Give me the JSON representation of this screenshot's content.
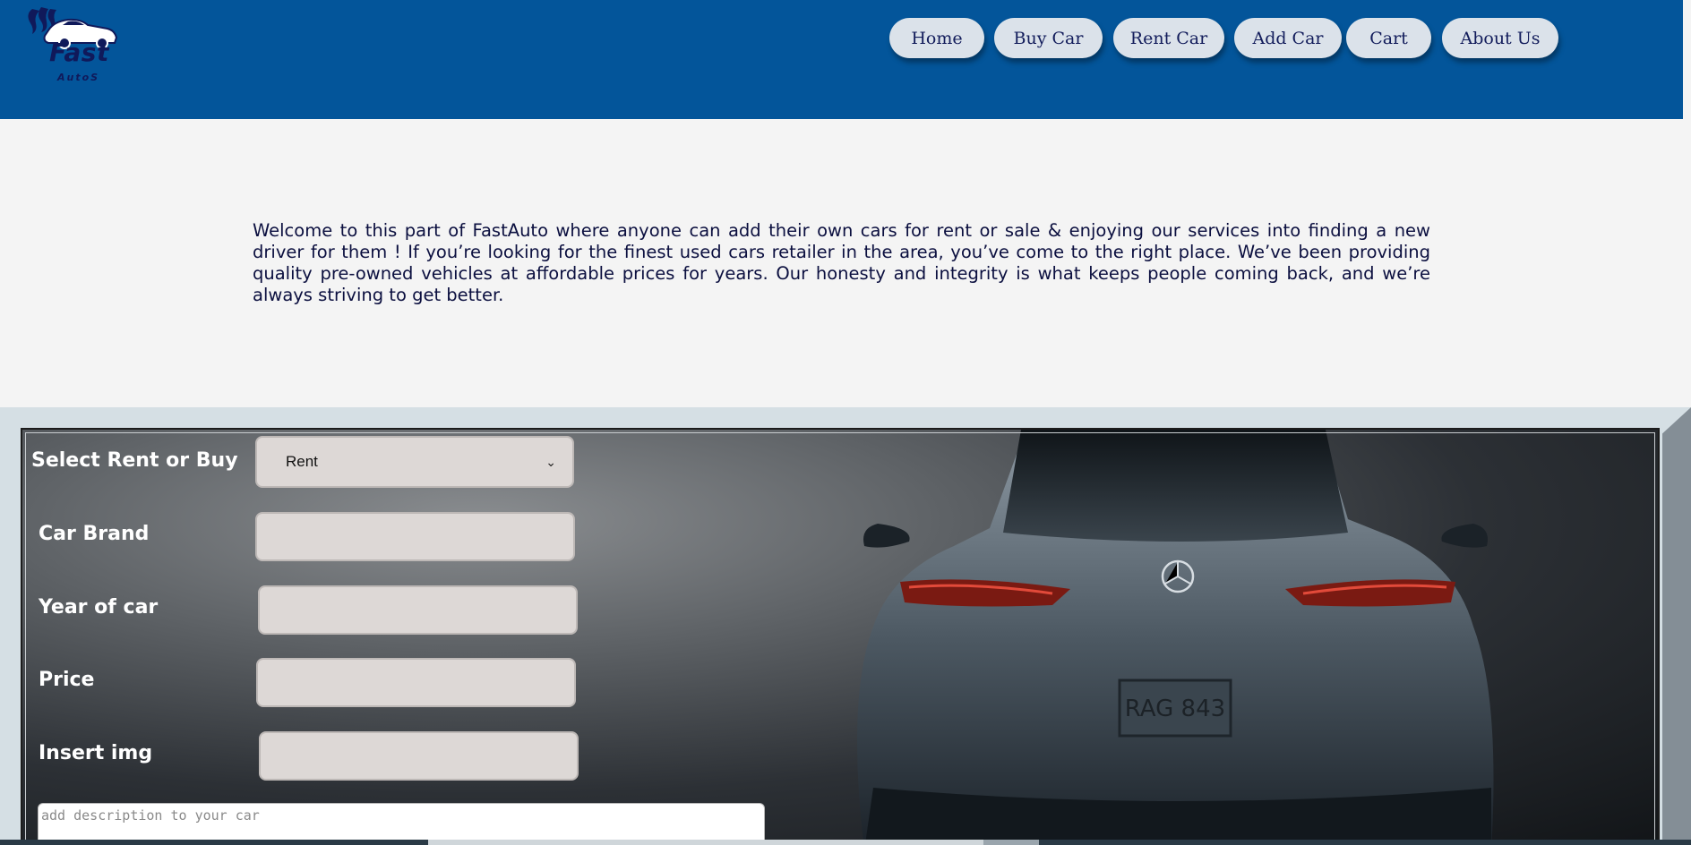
{
  "brand": {
    "name": "Fast",
    "sub": "AutoS"
  },
  "nav": {
    "items": [
      {
        "label": "Home"
      },
      {
        "label": "Buy Car"
      },
      {
        "label": "Rent Car"
      },
      {
        "label": "Add Car"
      },
      {
        "label": "Cart"
      },
      {
        "label": "About Us"
      }
    ]
  },
  "intro": {
    "text": "Welcome to this part of FastAuto where anyone can add their own cars for rent or sale & enjoying our services into finding a new driver for them ! If you’re looking for the finest used cars retailer in the area, you’ve come to the right place. We’ve been providing quality pre-owned vehicles at affordable prices for years. Our honesty and integrity is what keeps people coming back, and we’re always striving to get better."
  },
  "form": {
    "type_label": "Select Rent or Buy",
    "type_value": "Rent",
    "brand_label": "Car Brand",
    "year_label": "Year of car",
    "price_label": "Price",
    "img_label": "Insert img",
    "description_placeholder": "add description to your car"
  },
  "colors": {
    "header": "#03559a",
    "nav_button": "#dbe2ea",
    "nav_text": "#121c5b",
    "page_bg": "#f4f4f4",
    "input_bg": "#ddd8d6"
  }
}
